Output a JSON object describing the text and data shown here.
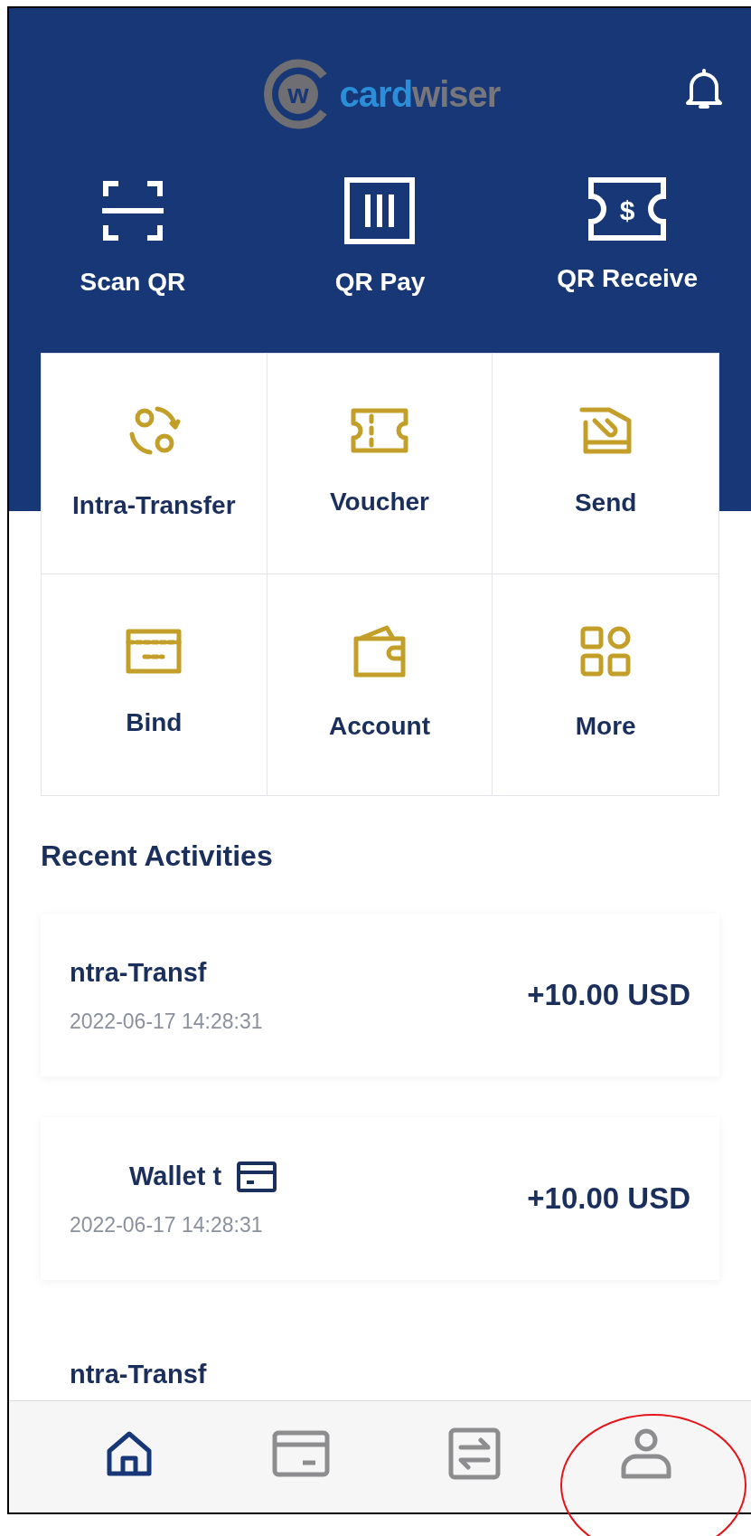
{
  "header": {
    "logo_mark": "w",
    "logo_text": [
      "card",
      "wiser"
    ]
  },
  "quick_actions": [
    {
      "label": "Scan QR",
      "kind": "scan"
    },
    {
      "label": "QR Pay",
      "kind": "pay"
    },
    {
      "label": "QR Receive",
      "kind": "receive",
      "icon_text": "$"
    }
  ],
  "services": [
    {
      "label": "Intra-Transfer",
      "kind": "transfer"
    },
    {
      "label": "Voucher",
      "kind": "voucher"
    },
    {
      "label": "Send",
      "kind": "send"
    },
    {
      "label": "Bind",
      "kind": "card"
    },
    {
      "label": "Account",
      "kind": "wallet"
    },
    {
      "label": "More",
      "kind": "more"
    }
  ],
  "recent_activities": {
    "title": "Recent Activities",
    "items": [
      {
        "title": "ntra-Transf",
        "time": "2022-06-17 14:28:31",
        "amount": "+10.00 USD",
        "card_icon": false
      },
      {
        "title": "Wallet t",
        "time": "2022-06-17 14:28:31",
        "amount": "+10.00 USD",
        "card_icon": true
      },
      {
        "title": "ntra-Transf",
        "card_icon": false
      }
    ]
  },
  "bottom_nav": [
    {
      "kind": "home",
      "selected": true
    },
    {
      "kind": "card",
      "selected": false
    },
    {
      "kind": "transfer",
      "selected": false
    },
    {
      "kind": "profile",
      "selected": false,
      "circled": true
    }
  ]
}
